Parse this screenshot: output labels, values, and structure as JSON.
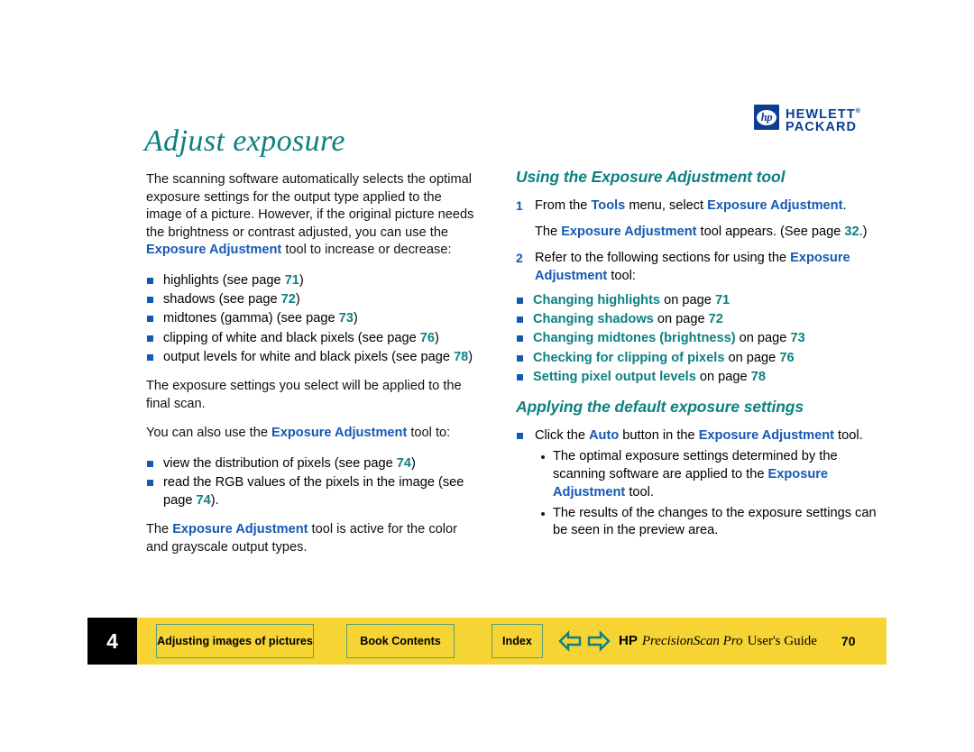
{
  "logo": {
    "mark_text": "hp",
    "line1": "HEWLETT",
    "line2": "PACKARD",
    "trademark": "®"
  },
  "page_title": "Adjust exposure",
  "colors": {
    "teal": "#0d8080",
    "blue": "#1659b3",
    "footer_yellow": "#f6d433",
    "button_border": "#5aa06e",
    "chapter_box": "#000000",
    "logo_blue": "#0b3d91"
  },
  "left_column": {
    "intro_paragraph": {
      "part1": "The scanning software automatically selects the optimal exposure settings for the output type applied to the image of a picture. However, if the original picture needs the brightness or contrast adjusted, you can use the ",
      "ui_term": "Exposure Adjustment",
      "part2": " tool to increase or decrease:"
    },
    "bullets": [
      {
        "text_before": "highlights (see page ",
        "page": "71",
        "text_after": ")"
      },
      {
        "text_before": "shadows (see page ",
        "page": "72",
        "text_after": ")"
      },
      {
        "text_before": "midtones (gamma) (see page ",
        "page": "73",
        "text_after": ")"
      },
      {
        "text_before": "clipping of white and black pixels (see page ",
        "page": "76",
        "text_after": ")"
      },
      {
        "text_before": "output levels for white and black pixels (see page ",
        "page": "78",
        "text_after": ")"
      }
    ],
    "paragraph_2": "The exposure settings you select will be applied to the final scan.",
    "paragraph_3": {
      "part1": "You can also use the ",
      "ui_term": "Exposure Adjustment",
      "part2": " tool to:"
    },
    "bullets_2": [
      {
        "text_before": "view the distribution of pixels (see page ",
        "page": "74",
        "text_after": ")"
      },
      {
        "text_before": "read the RGB values of the pixels in the image (see page ",
        "page": "74",
        "text_after": ")."
      }
    ],
    "paragraph_4": {
      "part1": "The ",
      "ui_term": "Exposure Adjustment",
      "part2": " tool is active for the color and grayscale output types."
    }
  },
  "right_column": {
    "section1_heading": "Using the Exposure Adjustment tool",
    "steps": [
      {
        "number": "1",
        "part1": "From the ",
        "ui1": "Tools",
        "part2": " menu, select ",
        "ui2": "Exposure Adjustment",
        "part3": ".",
        "sub_paragraph": {
          "part1": "The ",
          "ui_term": "Exposure Adjustment",
          "part2": " tool appears. (See page ",
          "page": "32",
          "part3": ".)"
        }
      },
      {
        "number": "2",
        "part1": "Refer to the following sections for using the ",
        "ui1": "Exposure Adjustment",
        "part2": " tool:"
      }
    ],
    "xref_bullets": [
      {
        "link": "Changing highlights",
        "mid": " on page ",
        "page": "71"
      },
      {
        "link": "Changing shadows",
        "mid": " on page ",
        "page": "72"
      },
      {
        "link": "Changing midtones (brightness)",
        "mid": " on page ",
        "page": "73"
      },
      {
        "link": "Checking for clipping of pixels",
        "mid": " on page ",
        "page": "76"
      },
      {
        "link": "Setting pixel output levels",
        "mid": " on page ",
        "page": "78"
      }
    ],
    "section2_heading": "Applying the default exposure settings",
    "action_bullet": {
      "part1": "Click the ",
      "ui1": "Auto",
      "part2": " button in the ",
      "ui2": "Exposure Adjustment",
      "part3": " tool."
    },
    "sub_bullets": [
      {
        "part1": "The optimal exposure settings determined by the scanning software are applied to the ",
        "ui_term": "Exposure Adjustment",
        "part2": " tool."
      },
      {
        "part1": "The results of the changes to the exposure settings can be seen in the preview area.",
        "ui_term": "",
        "part2": ""
      }
    ]
  },
  "footer": {
    "chapter_number": "4",
    "chapter_name": "Adjusting images of pictures",
    "book_contents_label": "Book Contents",
    "index_label": "Index",
    "prev_icon": "arrow-left-icon",
    "next_icon": "arrow-right-icon",
    "guide_hp": "HP",
    "guide_product": "PrecisionScan Pro",
    "guide_suffix": "User's Guide",
    "page_number": "70"
  }
}
